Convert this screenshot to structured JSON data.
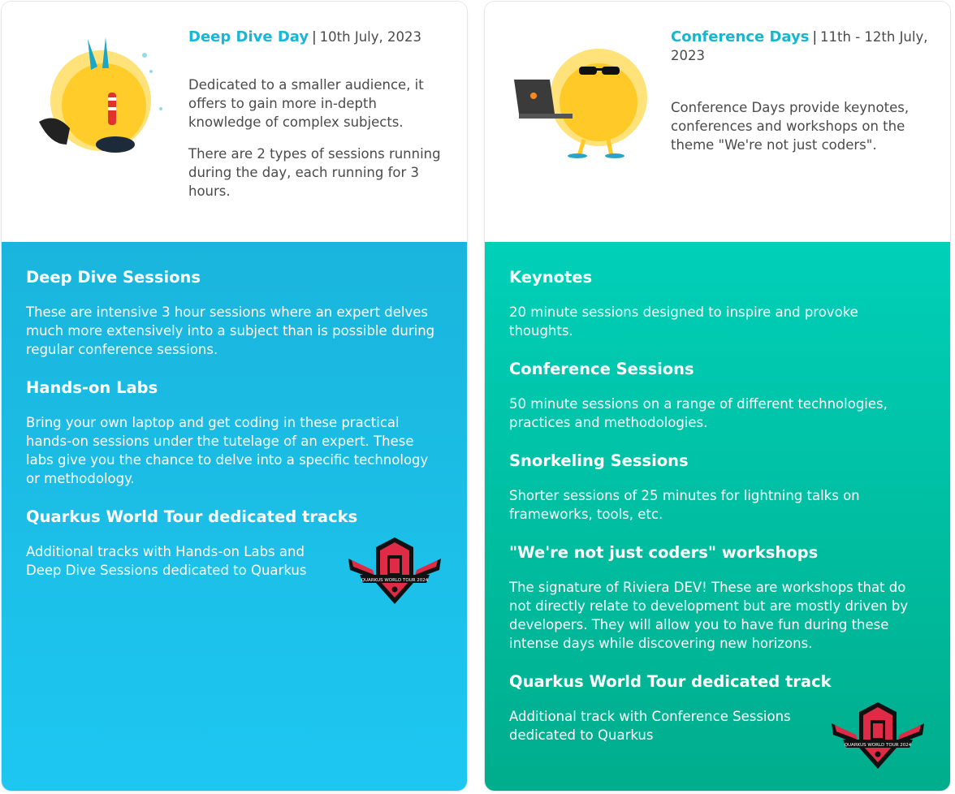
{
  "left_card": {
    "mascot_icon": "diver-sun-mascot",
    "title": "Deep Dive Day",
    "separator": "|",
    "date": "10th July, 2023",
    "intro_paragraphs": [
      "Dedicated to a smaller audience, it offers to gain more in-depth knowledge of complex subjects.",
      "There are 2 types of sessions running during the day, each running for 3 hours."
    ],
    "sections": [
      {
        "title": "Deep Dive Sessions",
        "text": "These are intensive 3 hour sessions where an expert delves much more extensively into a subject than is possible during regular conference sessions."
      },
      {
        "title": "Hands-on Labs",
        "text": "Bring your own laptop and get coding in these practical hands-on sessions under the tutelage of an expert. These labs give you the chance to delve into a specific technology or methodology."
      }
    ],
    "quarkus": {
      "title": "Quarkus World Tour dedicated tracks",
      "text": "Additional tracks with Hands-on Labs and Deep Dive Sessions dedicated to Quarkus",
      "logo_text": "QUARKUS WORLD TOUR 2024",
      "logo_icon": "quarkus-world-tour-logo"
    },
    "accent": "#1ab5dc"
  },
  "right_card": {
    "mascot_icon": "sun-laptop-mascot",
    "title": "Conference Days",
    "separator": "|",
    "date": "11th - 12th July, 2023",
    "intro_paragraphs": [
      "Conference Days provide keynotes, conferences and workshops on the theme \"We're not just coders\"."
    ],
    "sections": [
      {
        "title": "Keynotes",
        "text": "20 minute sessions designed to inspire and provoke thoughts."
      },
      {
        "title": "Conference Sessions",
        "text": "50 minute sessions on a range of different technologies, practices and methodologies."
      },
      {
        "title": "Snorkeling Sessions",
        "text": "Shorter sessions of 25 minutes for lightning talks on frameworks, tools, etc."
      },
      {
        "title": "\"We're not just coders\" workshops",
        "text": "The signature of Riviera DEV! These are workshops that do not directly relate to development but are mostly driven by developers. They will allow you to have fun during these intense days while discovering new horizons."
      }
    ],
    "quarkus": {
      "title": "Quarkus World Tour dedicated track",
      "text": "Additional track with Conference Sessions dedicated to Quarkus",
      "logo_text": "QUARKUS WORLD TOUR 2024",
      "logo_icon": "quarkus-world-tour-logo"
    },
    "accent": "#00c4a8"
  }
}
